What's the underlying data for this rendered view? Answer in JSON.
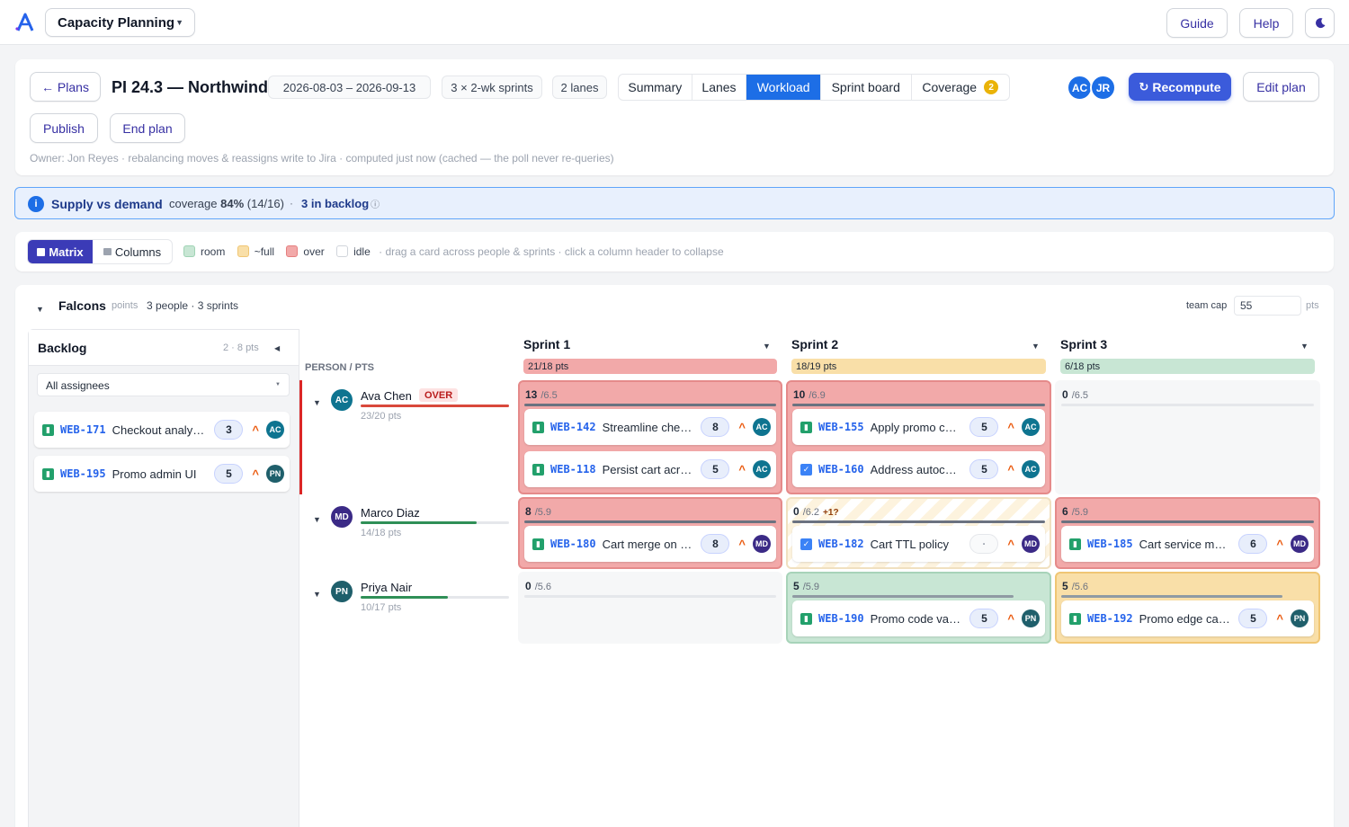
{
  "app": {
    "plan_selector": "Capacity Planning",
    "guide": "Guide",
    "help": "Help"
  },
  "header": {
    "back": "← Plans",
    "title": "PI 24.3 — Northwind",
    "dates": "2026-08-03 – 2026-09-13",
    "sprints": "3 × 2-wk sprints",
    "lanes": "2 lanes",
    "tabs": [
      "Summary",
      "Lanes",
      "Workload",
      "Sprint board",
      "Coverage"
    ],
    "coverage_badge": "2",
    "avatars": [
      "AC",
      "JR"
    ],
    "recompute": "Recompute",
    "edit_plan": "Edit plan",
    "publish": "Publish",
    "end_plan": "End plan",
    "owner_line": "Owner: Jon Reyes · rebalancing moves & reassigns write to Jira · computed just now (cached — the poll never re-queries)"
  },
  "banner": {
    "title": "Supply vs demand",
    "coverage_label": "coverage",
    "coverage_pct": "84%",
    "coverage_ratio": "(14/16)",
    "backlog": "3 in backlog"
  },
  "viewbar": {
    "matrix": "Matrix",
    "columns": "Columns",
    "legend": [
      "room",
      "~full",
      "over",
      "idle"
    ],
    "hint": "drag a card across people & sprints · click a column header to collapse"
  },
  "team": {
    "name": "Falcons",
    "unit": "points",
    "meta": "3 people · 3 sprints",
    "cap_label": "team cap",
    "cap_value": "55",
    "cap_unit": "pts"
  },
  "backlog": {
    "title": "Backlog",
    "meta": "2 · 8 pts",
    "filter": "All assignees",
    "items": [
      {
        "key": "WEB-171",
        "title": "Checkout analytics",
        "pts": "3",
        "who": "AC"
      },
      {
        "key": "WEB-195",
        "title": "Promo admin UI",
        "pts": "5",
        "who": "PN"
      }
    ]
  },
  "grid": {
    "col_label": "PERSON / PTS",
    "sprints": [
      {
        "name": "Sprint 1",
        "load": "21/18 pts"
      },
      {
        "name": "Sprint 2",
        "load": "18/19 pts"
      },
      {
        "name": "Sprint 3",
        "load": "6/18 pts"
      }
    ],
    "people": [
      {
        "initials": "AC",
        "name": "Ava Chen",
        "badge": "OVER",
        "load": "23/20 pts",
        "fill": 1.0
      },
      {
        "initials": "MD",
        "name": "Marco Diaz",
        "badge": "",
        "load": "14/18 pts",
        "fill": 0.78
      },
      {
        "initials": "PN",
        "name": "Priya Nair",
        "badge": "",
        "load": "10/17 pts",
        "fill": 0.59
      }
    ],
    "cells": [
      {
        "pts": "13",
        "cap": "/6.5",
        "extra": "",
        "tickets": [
          {
            "key": "WEB-142",
            "title": "Streamline checkout",
            "pts": "8",
            "who": "AC",
            "type": "story"
          },
          {
            "key": "WEB-118",
            "title": "Persist cart across sessions",
            "pts": "5",
            "who": "AC",
            "type": "story"
          }
        ]
      },
      {
        "pts": "10",
        "cap": "/6.9",
        "extra": "",
        "tickets": [
          {
            "key": "WEB-155",
            "title": "Apply promo codes",
            "pts": "5",
            "who": "AC",
            "type": "story"
          },
          {
            "key": "WEB-160",
            "title": "Address autocomplete",
            "pts": "5",
            "who": "AC",
            "type": "task"
          }
        ]
      },
      {
        "pts": "0",
        "cap": "/6.5",
        "extra": "",
        "tickets": []
      },
      {
        "pts": "8",
        "cap": "/5.9",
        "extra": "",
        "tickets": [
          {
            "key": "WEB-180",
            "title": "Cart merge on login",
            "pts": "8",
            "who": "MD",
            "type": "story"
          }
        ]
      },
      {
        "pts": "0",
        "cap": "/6.2",
        "extra": "+1?",
        "tickets": [
          {
            "key": "WEB-182",
            "title": "Cart TTL policy",
            "pts": "·",
            "who": "MD",
            "type": "task"
          }
        ]
      },
      {
        "pts": "6",
        "cap": "/5.9",
        "extra": "",
        "tickets": [
          {
            "key": "WEB-185",
            "title": "Cart service metrics",
            "pts": "6",
            "who": "MD",
            "type": "story"
          }
        ]
      },
      {
        "pts": "0",
        "cap": "/5.6",
        "extra": "",
        "tickets": []
      },
      {
        "pts": "5",
        "cap": "/5.9",
        "extra": "",
        "tickets": [
          {
            "key": "WEB-190",
            "title": "Promo code validation",
            "pts": "5",
            "who": "PN",
            "type": "story"
          }
        ]
      },
      {
        "pts": "5",
        "cap": "/5.6",
        "extra": "",
        "tickets": [
          {
            "key": "WEB-192",
            "title": "Promo edge cases",
            "pts": "5",
            "who": "PN",
            "type": "story"
          }
        ]
      }
    ]
  },
  "colors": {
    "accent": "#1d6ee6",
    "indigo": "#3730a3",
    "room": "#c8e6d4",
    "full": "#f9dfa8",
    "over": "#f2a9a9",
    "over_line": "#dc2626"
  }
}
